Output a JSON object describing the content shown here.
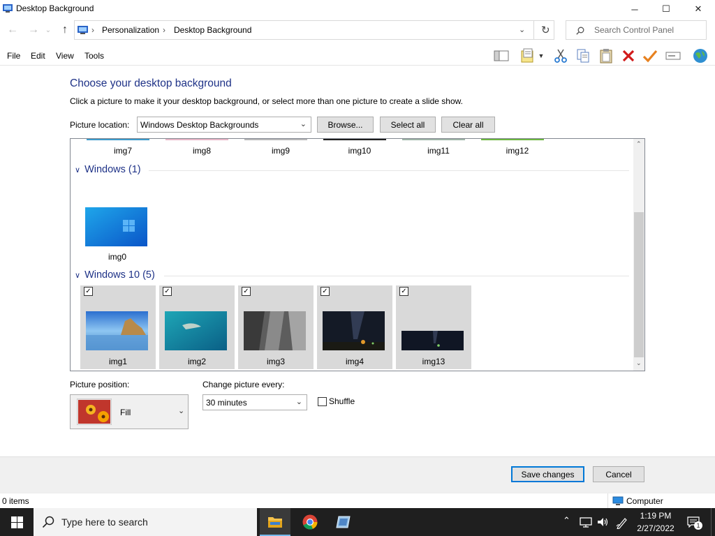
{
  "window": {
    "title": "Desktop Background",
    "minimize": "─",
    "maximize": "☐",
    "close": "✕"
  },
  "nav": {
    "back": "←",
    "forward": "→",
    "recent": "⌄",
    "up": "↑",
    "breadcrumbs": [
      "Personalization",
      "Desktop Background"
    ],
    "separator": "›",
    "refresh": "↻",
    "search_placeholder": "Search Control Panel"
  },
  "menu": [
    "File",
    "Edit",
    "View",
    "Tools"
  ],
  "toolbar_icons": [
    "layout-icon",
    "properties-icon",
    "cut-icon",
    "copy-icon",
    "paste-icon",
    "delete-icon",
    "check-icon",
    "rename-icon",
    "globe-icon"
  ],
  "content": {
    "heading": "Choose your desktop background",
    "description": "Click a picture to make it your desktop background, or select more than one picture to create a slide show.",
    "location_label": "Picture location:",
    "location_value": "Windows Desktop Backgrounds",
    "browse": "Browse...",
    "select_all": "Select all",
    "clear_all": "Clear all"
  },
  "gallery": {
    "top_row": [
      "img7",
      "img8",
      "img9",
      "img10",
      "img11",
      "img12"
    ],
    "groups": [
      {
        "title": "Windows (1)",
        "items": [
          {
            "name": "img0",
            "selected": false
          }
        ]
      },
      {
        "title": "Windows 10 (5)",
        "items": [
          {
            "name": "img1",
            "selected": true
          },
          {
            "name": "img2",
            "selected": true
          },
          {
            "name": "img3",
            "selected": true
          },
          {
            "name": "img4",
            "selected": true
          },
          {
            "name": "img13",
            "selected": true
          }
        ]
      }
    ]
  },
  "position": {
    "label": "Picture position:",
    "value": "Fill"
  },
  "interval": {
    "label": "Change picture every:",
    "value": "30 minutes"
  },
  "shuffle": {
    "label": "Shuffle",
    "checked": false
  },
  "actions": {
    "save": "Save changes",
    "cancel": "Cancel"
  },
  "status": {
    "items": "0 items",
    "location": "Computer"
  },
  "taskbar": {
    "search_placeholder": "Type here to search",
    "time": "1:19 PM",
    "date": "2/27/2022",
    "notifications": "1"
  }
}
